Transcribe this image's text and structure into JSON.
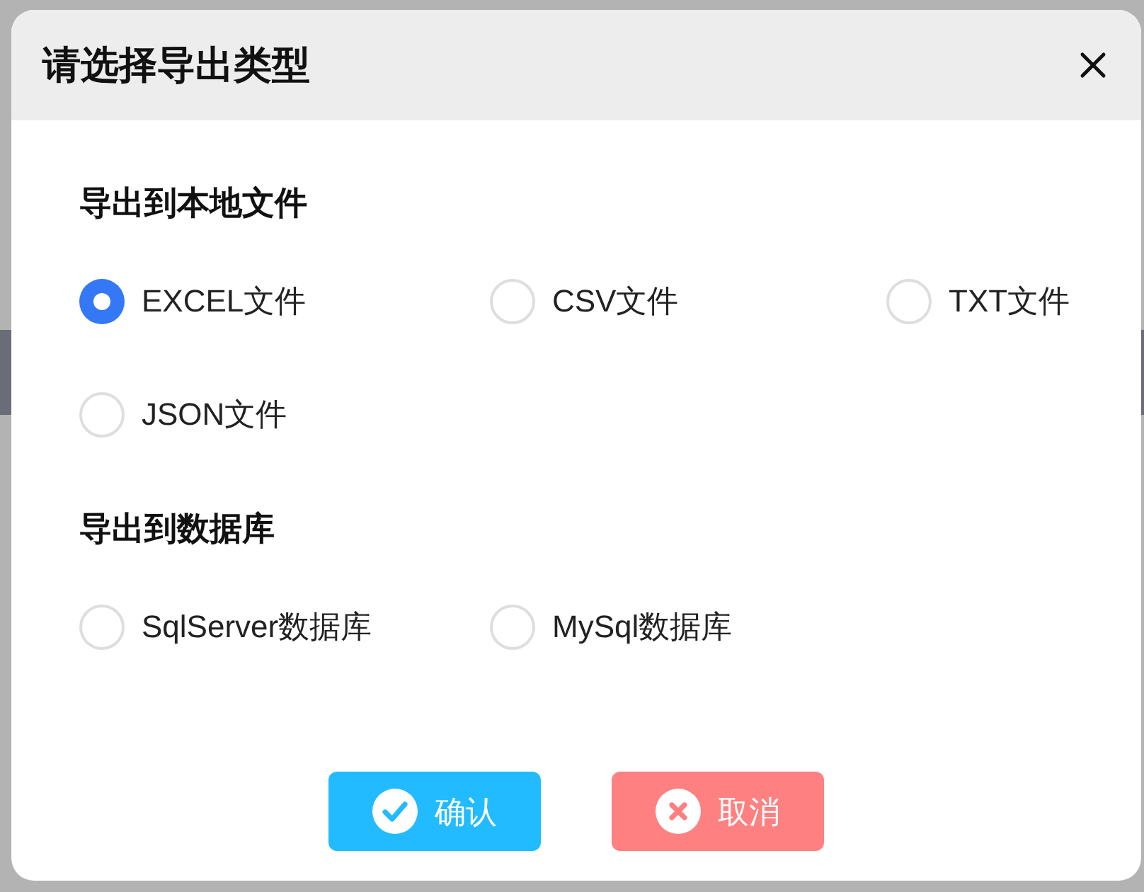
{
  "dialog": {
    "title": "请选择导出类型",
    "sections": [
      {
        "heading": "导出到本地文件",
        "options": [
          {
            "label": "EXCEL文件",
            "selected": true
          },
          {
            "label": "CSV文件",
            "selected": false
          },
          {
            "label": "TXT文件",
            "selected": false
          },
          {
            "label": "JSON文件",
            "selected": false
          }
        ]
      },
      {
        "heading": "导出到数据库",
        "options": [
          {
            "label": "SqlServer数据库",
            "selected": false
          },
          {
            "label": "MySql数据库",
            "selected": false
          }
        ]
      }
    ],
    "buttons": [
      {
        "kind": "confirm",
        "label": "确认"
      },
      {
        "kind": "cancel",
        "label": "取消"
      }
    ]
  }
}
